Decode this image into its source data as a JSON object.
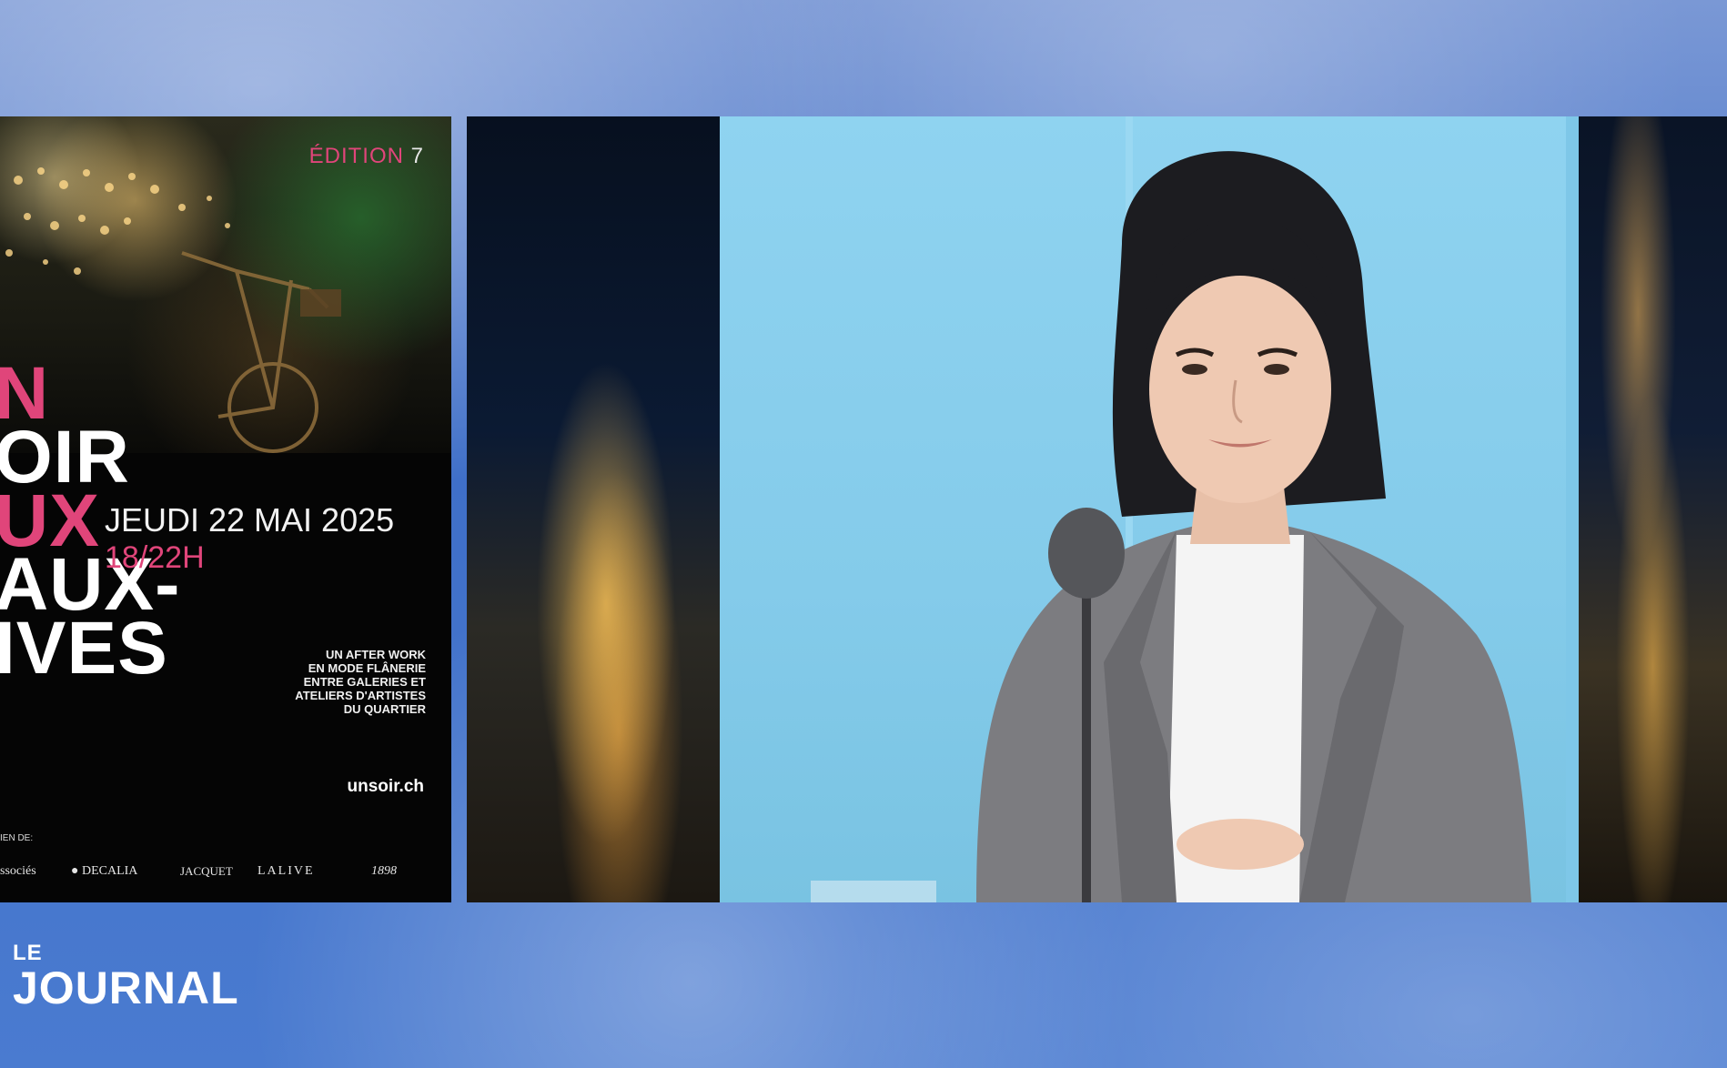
{
  "poster": {
    "edition_label": "ÉDITION",
    "edition_number": "7",
    "title_lines": [
      "N",
      "OIR",
      "UX",
      "AUX-",
      "IVES"
    ],
    "date": "JEUDI 22 MAI 2025",
    "hours": "18/22H",
    "tagline": [
      "UN AFTER WORK",
      "EN MODE FLÂNERIE",
      "ENTRE GALERIES ET",
      "ATELIERS D'ARTISTES",
      "DU QUARTIER"
    ],
    "website": "unsoir.ch",
    "sponsor_label": "IEN DE:",
    "sponsors": [
      "ssociés",
      "DECALIA",
      "JACQUET",
      "LALIVE",
      "1898"
    ]
  },
  "logo": {
    "le": "LE",
    "journal": "JOURNAL"
  },
  "colors": {
    "accent_pink": "#e0457a",
    "studio_backdrop": "#84cbea",
    "sky_blue": "#4f79c9"
  }
}
